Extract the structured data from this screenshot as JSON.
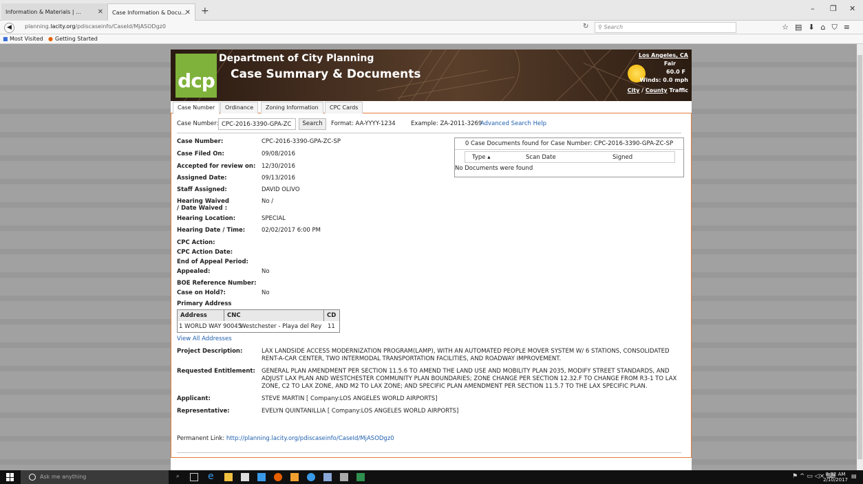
{
  "browser": {
    "tabs": [
      {
        "label": "Information & Materials | ..."
      },
      {
        "label": "Case Information & Docu..."
      }
    ],
    "url_prefix": "planning.",
    "url_domain": "lacity.org",
    "url_path": "/pdiscaseinfo/CaseId/MjASODgz0",
    "search_placeholder": "Search",
    "bookmarks": [
      "Most Visited",
      "Getting Started"
    ]
  },
  "banner": {
    "logo_text": "dcp",
    "department": "Department of City Planning",
    "title": "Case Summary & Documents",
    "weather": {
      "city": "Los Angeles, CA",
      "condition": "Fair",
      "temp": "60.0 F",
      "winds": "Winds: 0.0 mph",
      "city_link": "City",
      "sep": "/",
      "county_link": "County",
      "traffic": "Traffic"
    }
  },
  "page_tabs": [
    "Case Number",
    "Ordinance",
    "Zoning Information",
    "CPC Cards"
  ],
  "search": {
    "label": "Case Number:",
    "value": "CPC-2016-3390-GPA-ZC",
    "button": "Search",
    "format": "Format: AA-YYYY-1234",
    "example": "Example: ZA-2011-3269",
    "help_link": "Advanced Search Help"
  },
  "fields": [
    {
      "label": "Case Number:",
      "value": "CPC-2016-3390-GPA-ZC-SP"
    },
    {
      "label": "Case Filed On:",
      "value": "09/08/2016"
    },
    {
      "label": "Accepted for review on:",
      "value": "12/30/2016"
    },
    {
      "label": "Assigned Date:",
      "value": "09/13/2016"
    },
    {
      "label": "Staff Assigned:",
      "value": "DAVID OLIVO"
    },
    {
      "label": "Hearing Waived",
      "label2": "/ Date Waived :",
      "value": "No /"
    },
    {
      "label": "Hearing Location:",
      "value": "SPECIAL"
    },
    {
      "label": "Hearing Date / Time:",
      "value": "02/02/2017 6:00 PM"
    },
    {
      "label": "CPC Action:",
      "value": ""
    },
    {
      "label": "CPC Action Date:",
      "value": ""
    },
    {
      "label": "End of Appeal Period:",
      "value": ""
    },
    {
      "label": "Appealed:",
      "value": "No"
    },
    {
      "label": "BOE Reference Number:",
      "value": ""
    },
    {
      "label": "Case on Hold?:",
      "value": "No"
    }
  ],
  "documents": {
    "header": "0 Case Documents found for Case Number: CPC-2016-3390-GPA-ZC-SP",
    "columns": [
      "Type ▴",
      "Scan Date",
      "Signed"
    ],
    "empty": "No Documents were found"
  },
  "address": {
    "title": "Primary Address",
    "columns": [
      "Address",
      "CNC",
      "CD"
    ],
    "row": [
      "1 WORLD WAY 90045",
      "Westchester - Playa del Rey",
      "11"
    ],
    "view_all": "View All Addresses"
  },
  "details": {
    "project_label": "Project Description:",
    "project": "LAX LANDSIDE ACCESS MODERNIZATION PROGRAM(LAMP), WITH AN AUTOMATED PEOPLE MOVER SYSTEM W/ 6 STATIONS, CONSOLIDATED RENT-A-CAR CENTER, TWO INTERMODAL TRANSPORTATION FACILITIES, AND ROADWAY IMPROVEMENT.",
    "entitlement_label": "Requested Entitlement:",
    "entitlement": "GENERAL PLAN AMENDMENT PER SECTION 11.5.6 TO AMEND THE LAND USE AND MOBILITY PLAN 2035, MODIFY STREET STANDARDS, AND ADJUST LAX PLAN AND WESTCHESTER COMMUNITY PLAN BOUNDARIES; ZONE CHANGE PER SECTION 12.32.F TO CHANGE FROM R3-1 TO LAX ZONE, C2 TO LAX ZONE, AND M2 TO LAX ZONE; AND SPECIFIC PLAN AMENDMENT PER SECTION 11.5.7 TO THE LAX SPECIFIC PLAN.",
    "applicant_label": "Applicant:",
    "applicant": "STEVE MARTIN [ Company:LOS ANGELES WORLD AIRPORTS]",
    "rep_label": "Representative:",
    "rep": "EVELYN QUINTANILLIA [ Company:LOS ANGELES WORLD AIRPORTS]"
  },
  "permalink": {
    "label": "Permanent Link:",
    "url": "http://planning.lacity.org/pdiscaseinfo/CaseId/MjASODgz0"
  },
  "taskbar": {
    "search": "Ask me anything",
    "time": "8:32 AM",
    "date": "2/10/2017"
  },
  "colors": {
    "accent": "#e27c3a",
    "link": "#1f5fae",
    "logo_green": "#7fb23a"
  }
}
